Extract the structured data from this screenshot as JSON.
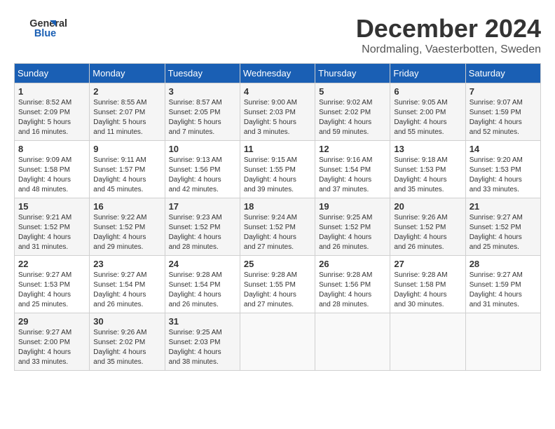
{
  "logo": {
    "line1": "General",
    "line2": "Blue"
  },
  "title": "December 2024",
  "subtitle": "Nordmaling, Vaesterbotten, Sweden",
  "headers": [
    "Sunday",
    "Monday",
    "Tuesday",
    "Wednesday",
    "Thursday",
    "Friday",
    "Saturday"
  ],
  "weeks": [
    [
      {
        "day": "1",
        "info": "Sunrise: 8:52 AM\nSunset: 2:09 PM\nDaylight: 5 hours\nand 16 minutes."
      },
      {
        "day": "2",
        "info": "Sunrise: 8:55 AM\nSunset: 2:07 PM\nDaylight: 5 hours\nand 11 minutes."
      },
      {
        "day": "3",
        "info": "Sunrise: 8:57 AM\nSunset: 2:05 PM\nDaylight: 5 hours\nand 7 minutes."
      },
      {
        "day": "4",
        "info": "Sunrise: 9:00 AM\nSunset: 2:03 PM\nDaylight: 5 hours\nand 3 minutes."
      },
      {
        "day": "5",
        "info": "Sunrise: 9:02 AM\nSunset: 2:02 PM\nDaylight: 4 hours\nand 59 minutes."
      },
      {
        "day": "6",
        "info": "Sunrise: 9:05 AM\nSunset: 2:00 PM\nDaylight: 4 hours\nand 55 minutes."
      },
      {
        "day": "7",
        "info": "Sunrise: 9:07 AM\nSunset: 1:59 PM\nDaylight: 4 hours\nand 52 minutes."
      }
    ],
    [
      {
        "day": "8",
        "info": "Sunrise: 9:09 AM\nSunset: 1:58 PM\nDaylight: 4 hours\nand 48 minutes."
      },
      {
        "day": "9",
        "info": "Sunrise: 9:11 AM\nSunset: 1:57 PM\nDaylight: 4 hours\nand 45 minutes."
      },
      {
        "day": "10",
        "info": "Sunrise: 9:13 AM\nSunset: 1:56 PM\nDaylight: 4 hours\nand 42 minutes."
      },
      {
        "day": "11",
        "info": "Sunrise: 9:15 AM\nSunset: 1:55 PM\nDaylight: 4 hours\nand 39 minutes."
      },
      {
        "day": "12",
        "info": "Sunrise: 9:16 AM\nSunset: 1:54 PM\nDaylight: 4 hours\nand 37 minutes."
      },
      {
        "day": "13",
        "info": "Sunrise: 9:18 AM\nSunset: 1:53 PM\nDaylight: 4 hours\nand 35 minutes."
      },
      {
        "day": "14",
        "info": "Sunrise: 9:20 AM\nSunset: 1:53 PM\nDaylight: 4 hours\nand 33 minutes."
      }
    ],
    [
      {
        "day": "15",
        "info": "Sunrise: 9:21 AM\nSunset: 1:52 PM\nDaylight: 4 hours\nand 31 minutes."
      },
      {
        "day": "16",
        "info": "Sunrise: 9:22 AM\nSunset: 1:52 PM\nDaylight: 4 hours\nand 29 minutes."
      },
      {
        "day": "17",
        "info": "Sunrise: 9:23 AM\nSunset: 1:52 PM\nDaylight: 4 hours\nand 28 minutes."
      },
      {
        "day": "18",
        "info": "Sunrise: 9:24 AM\nSunset: 1:52 PM\nDaylight: 4 hours\nand 27 minutes."
      },
      {
        "day": "19",
        "info": "Sunrise: 9:25 AM\nSunset: 1:52 PM\nDaylight: 4 hours\nand 26 minutes."
      },
      {
        "day": "20",
        "info": "Sunrise: 9:26 AM\nSunset: 1:52 PM\nDaylight: 4 hours\nand 26 minutes."
      },
      {
        "day": "21",
        "info": "Sunrise: 9:27 AM\nSunset: 1:52 PM\nDaylight: 4 hours\nand 25 minutes."
      }
    ],
    [
      {
        "day": "22",
        "info": "Sunrise: 9:27 AM\nSunset: 1:53 PM\nDaylight: 4 hours\nand 25 minutes."
      },
      {
        "day": "23",
        "info": "Sunrise: 9:27 AM\nSunset: 1:54 PM\nDaylight: 4 hours\nand 26 minutes."
      },
      {
        "day": "24",
        "info": "Sunrise: 9:28 AM\nSunset: 1:54 PM\nDaylight: 4 hours\nand 26 minutes."
      },
      {
        "day": "25",
        "info": "Sunrise: 9:28 AM\nSunset: 1:55 PM\nDaylight: 4 hours\nand 27 minutes."
      },
      {
        "day": "26",
        "info": "Sunrise: 9:28 AM\nSunset: 1:56 PM\nDaylight: 4 hours\nand 28 minutes."
      },
      {
        "day": "27",
        "info": "Sunrise: 9:28 AM\nSunset: 1:58 PM\nDaylight: 4 hours\nand 30 minutes."
      },
      {
        "day": "28",
        "info": "Sunrise: 9:27 AM\nSunset: 1:59 PM\nDaylight: 4 hours\nand 31 minutes."
      }
    ],
    [
      {
        "day": "29",
        "info": "Sunrise: 9:27 AM\nSunset: 2:00 PM\nDaylight: 4 hours\nand 33 minutes."
      },
      {
        "day": "30",
        "info": "Sunrise: 9:26 AM\nSunset: 2:02 PM\nDaylight: 4 hours\nand 35 minutes."
      },
      {
        "day": "31",
        "info": "Sunrise: 9:25 AM\nSunset: 2:03 PM\nDaylight: 4 hours\nand 38 minutes."
      },
      null,
      null,
      null,
      null
    ]
  ]
}
